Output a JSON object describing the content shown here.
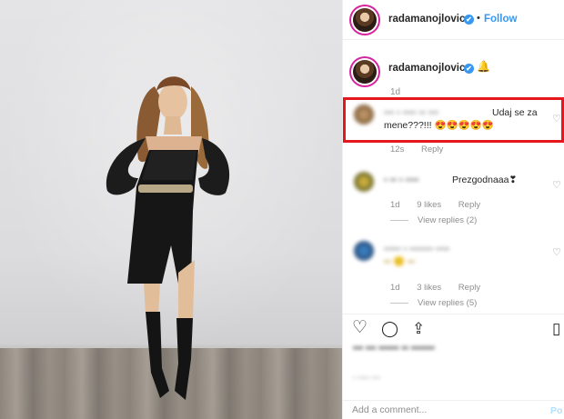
{
  "header": {
    "username": "radamanojlovic",
    "verified_icon": "✔",
    "separator": "•",
    "follow_label": "Follow"
  },
  "caption": {
    "username": "radamanojlovic",
    "verified_icon": "✔",
    "emoji": "🔔",
    "time": "1d"
  },
  "comments": [
    {
      "text_blurred_name": "▪▪▪ ▪ ▪▪▪▪ ▪▪ ▪▪▪",
      "text_line1": "Udaj se za",
      "text_line2": "mene???!!! 😍😍😍😍😍",
      "time": "12s",
      "reply_label": "Reply",
      "highlighted": true
    },
    {
      "text_blurred_name": "▪ ▪▪ ▪ ▪▪▪▪",
      "text": "Prezgodnaaa❣",
      "time": "1d",
      "likes": "9 likes",
      "reply_label": "Reply",
      "view_replies": "View replies (2)"
    },
    {
      "text_blurred_name": "▪▪▪▪▪ ▪ ▪▪▪▪▪▪▪ ▪▪▪▪",
      "time": "1d",
      "likes": "3 likes",
      "reply_label": "Reply",
      "view_replies": "View replies (5)"
    }
  ],
  "actions": {
    "like_icon": "♡",
    "comment_icon": "◯",
    "share_icon": "⇪",
    "save_icon": "▯"
  },
  "likes_blurred": "▪▪▪  ▪▪▪ ▪▪▪▪▪▪ ▪▪ ▪▪▪▪▪▪▪",
  "post_time_blurred": "▪ ▪▪▪▪ ▪▪▪",
  "add_comment": {
    "placeholder": "Add a comment...",
    "post_label": "Po"
  },
  "colors": {
    "accent_blue": "#3897f0",
    "highlight_red": "#e5171c",
    "muted_gray": "#8e8e8e"
  }
}
